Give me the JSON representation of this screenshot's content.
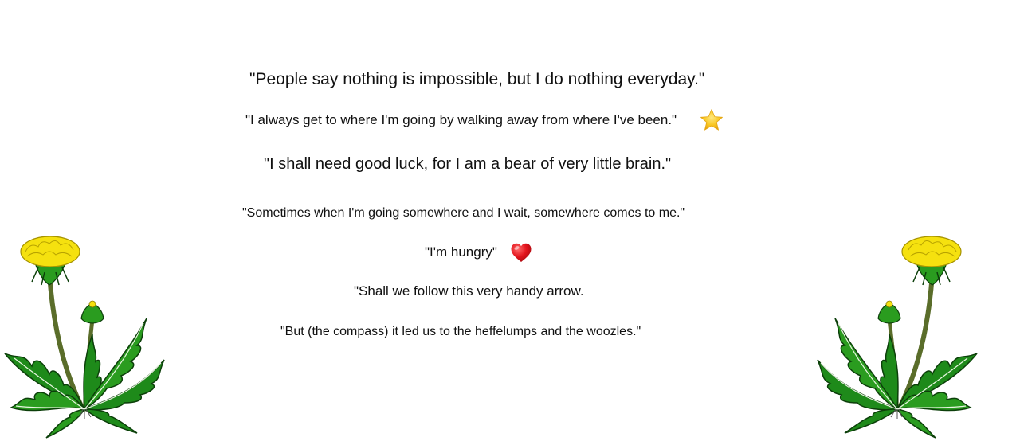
{
  "quotes": [
    "\"People say nothing is impossible, but I do nothing everyday.\"",
    "\"I always get to where I'm going by walking away from where I've been.\"",
    "\"I shall need good luck, for I am a bear of very little brain.\"",
    "\"Sometimes when I'm going somewhere and I wait, somewhere comes to me.\"",
    "\"I'm hungry\"",
    "\"Shall we follow this very handy arrow.",
    "\"But (the compass) it led us to the heffelumps and the woozles.\""
  ],
  "icons": {
    "star": "star-icon",
    "heart": "heart-icon",
    "plant": "dandelion-icon"
  },
  "colors": {
    "background": "#ffffff",
    "text": "#111111",
    "star": "#f8c21a",
    "heart": "#e0141b",
    "flower": "#f5e10f",
    "leaf": "#1e8a1a",
    "stem": "#5a6d2a"
  }
}
